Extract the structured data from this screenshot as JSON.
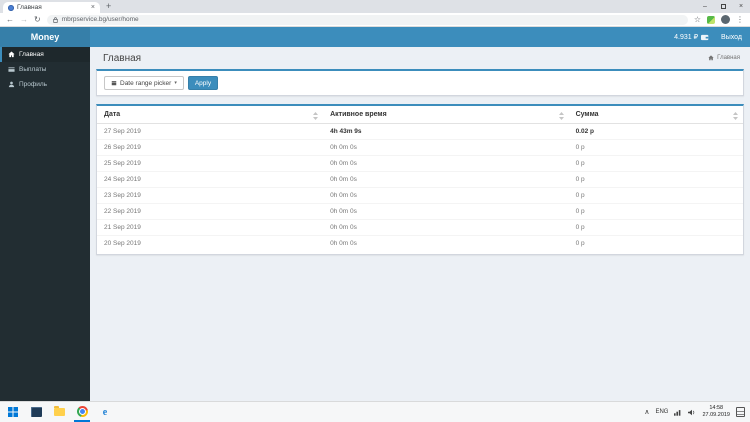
{
  "icons": {
    "back": "←",
    "forward": "→",
    "reload": "↻",
    "star": "☆",
    "menu": "⋮",
    "minimize": "–",
    "close": "×",
    "tab_close": "×",
    "new_tab": "+",
    "caret": "▾",
    "chevron_up": "∧",
    "ie_letter": "e"
  },
  "browser": {
    "tab_title": "Главная",
    "url": "mbrpservice.bg/user/home"
  },
  "app": {
    "brand": "Money",
    "navbar": {
      "balance": "4.931 ₽",
      "logout": "Выход"
    },
    "sidebar": {
      "items": [
        {
          "label": "Главная"
        },
        {
          "label": "Выплаты"
        },
        {
          "label": "Профиль"
        }
      ]
    },
    "page": {
      "title": "Главная",
      "breadcrumb": "Главная",
      "filter": {
        "date_range": "Date range picker",
        "apply": "Apply"
      },
      "table": {
        "columns": [
          "Дата",
          "Активное время",
          "Сумма"
        ],
        "rows": [
          [
            "27 Sep 2019",
            "4h 43m 9s",
            "0.02 р"
          ],
          [
            "26 Sep 2019",
            "0h 0m 0s",
            "0 р"
          ],
          [
            "25 Sep 2019",
            "0h 0m 0s",
            "0 р"
          ],
          [
            "24 Sep 2019",
            "0h 0m 0s",
            "0 р"
          ],
          [
            "23 Sep 2019",
            "0h 0m 0s",
            "0 р"
          ],
          [
            "22 Sep 2019",
            "0h 0m 0s",
            "0 р"
          ],
          [
            "21 Sep 2019",
            "0h 0m 0s",
            "0 р"
          ],
          [
            "20 Sep 2019",
            "0h 0m 0s",
            "0 р"
          ]
        ]
      }
    }
  },
  "taskbar": {
    "lang": "ENG",
    "time": "14:58",
    "date": "27.09.2019"
  },
  "colors": {
    "accent": "#3c8dbc",
    "logo_bg": "#367fa9",
    "sidebar_bg": "#222d32"
  }
}
